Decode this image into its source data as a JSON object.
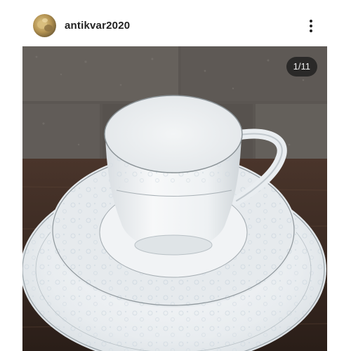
{
  "post": {
    "username": "antikvar2020",
    "image_counter": "1/11"
  },
  "icons": {
    "avatar": "avatar-image",
    "more": "more-options-icon"
  }
}
